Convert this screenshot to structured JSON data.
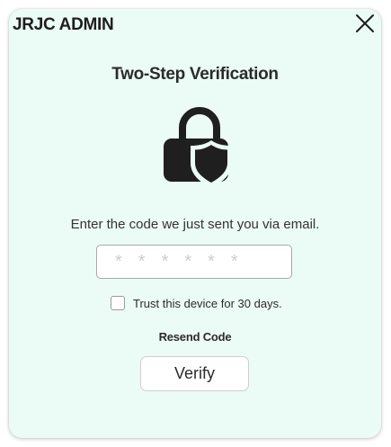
{
  "app": {
    "brand": "JRJC ADMIN"
  },
  "dialog": {
    "title": "Two-Step Verification",
    "icon": "lock-shield-icon",
    "instruction": "Enter the code we just sent you via email.",
    "code_input": {
      "value": "",
      "placeholder": "******"
    },
    "trust_device": {
      "label": "Trust this device for 30 days.",
      "checked": false
    },
    "resend_label": "Resend Code",
    "verify_label": "Verify",
    "close_icon": "close-icon"
  },
  "colors": {
    "dialog_background": "#ebfbf5",
    "text_primary": "#2b2b2b",
    "icon_fill": "#1f1f1f"
  }
}
